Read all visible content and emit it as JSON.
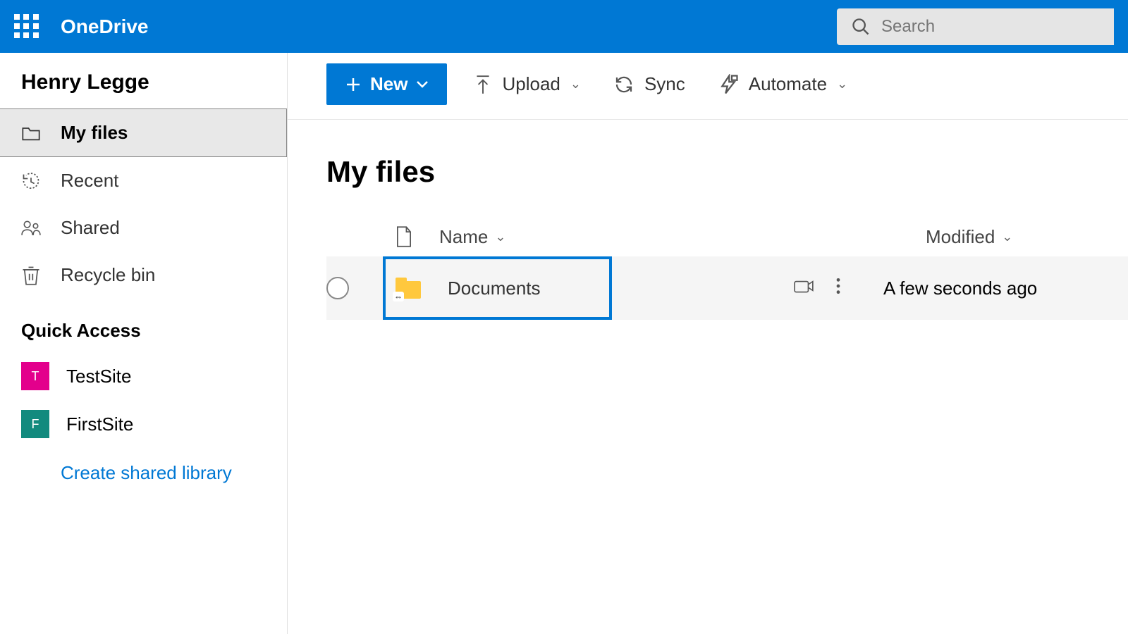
{
  "header": {
    "app_title": "OneDrive",
    "search_placeholder": "Search"
  },
  "sidebar": {
    "user_name": "Henry Legge",
    "nav": [
      {
        "label": "My files",
        "icon": "folder-icon"
      },
      {
        "label": "Recent",
        "icon": "recent-icon"
      },
      {
        "label": "Shared",
        "icon": "shared-icon"
      },
      {
        "label": "Recycle bin",
        "icon": "recycle-icon"
      }
    ],
    "quick_access_title": "Quick Access",
    "quick_access": [
      {
        "label": "TestSite",
        "initial": "T",
        "color": "#e3008c"
      },
      {
        "label": "FirstSite",
        "initial": "F",
        "color": "#128a7e"
      }
    ],
    "create_link": "Create shared library"
  },
  "toolbar": {
    "new_label": "New",
    "upload_label": "Upload",
    "sync_label": "Sync",
    "automate_label": "Automate"
  },
  "main": {
    "page_title": "My files",
    "columns": {
      "name": "Name",
      "modified": "Modified"
    },
    "rows": [
      {
        "name": "Documents",
        "modified": "A few seconds ago",
        "type": "folder-link"
      }
    ]
  }
}
